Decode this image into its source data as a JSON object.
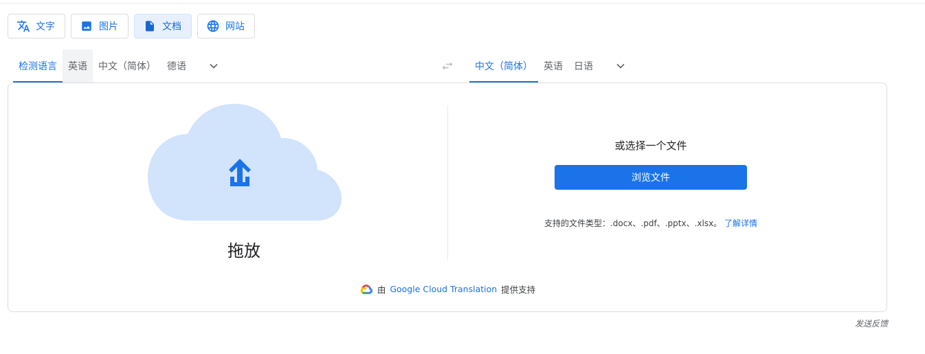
{
  "mode_tabs": [
    {
      "label": "文字",
      "icon": "translate-icon"
    },
    {
      "label": "图片",
      "icon": "image-icon"
    },
    {
      "label": "文档",
      "icon": "document-icon"
    },
    {
      "label": "网站",
      "icon": "globe-icon"
    }
  ],
  "source_languages": [
    "检测语言",
    "英语",
    "中文（简体）",
    "德语"
  ],
  "target_languages": [
    "中文（简体）",
    "英语",
    "日语"
  ],
  "drop_label": "拖放",
  "choose_label": "或选择一个文件",
  "browse_label": "浏览文件",
  "file_types_text": "支持的文件类型：.docx、.pdf、.pptx、.xlsx。",
  "learn_more": "了解详情",
  "powered": {
    "prefix": "由",
    "brand": "Google Cloud Translation",
    "suffix": "提供支持"
  },
  "feedback": "发送反馈",
  "colors": {
    "accent": "#1a73e8",
    "cloud": "#d2e3fc",
    "active_tab_bg": "#e8f0fe"
  }
}
